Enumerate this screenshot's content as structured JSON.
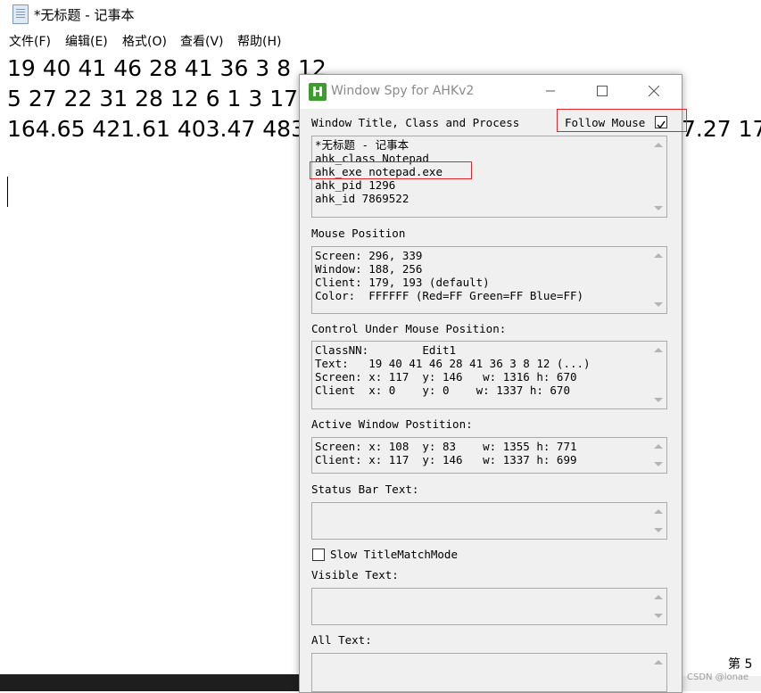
{
  "notepad": {
    "title": "*无标题 - 记事本",
    "menu": [
      "文件(F)",
      "编辑(E)",
      "格式(O)",
      "查看(V)",
      "帮助(H)"
    ],
    "lines": [
      "19 40 41 46 28 41 36 3 8 12",
      "5 27 22 31 28 12 6 1 3 17",
      "164.65 421.61 403.47 483"
    ],
    "right_fragment": "7.27 17",
    "status_page": "第 5"
  },
  "spy": {
    "title": "Window Spy for AHKv2",
    "logo_letter": "H",
    "window_section_label": "Window Title, Class and Process",
    "follow_mouse_label": "Follow Mouse",
    "follow_mouse_checked": true,
    "window_lines": [
      "*无标题 - 记事本",
      "ahk_class Notepad",
      "ahk_exe notepad.exe",
      "ahk_pid 1296",
      "ahk_id 7869522"
    ],
    "mouse_label": "Mouse Position",
    "mouse_lines": [
      "Screen: 296, 339",
      "Window: 188, 256",
      "Client: 179, 193 (default)",
      "Color:  FFFFFF (Red=FF Green=FF Blue=FF)"
    ],
    "control_label": "Control Under Mouse Position:",
    "control_lines": [
      "ClassNN:        Edit1",
      "Text:   19 40 41 46 28 41 36 3 8 12 (...)",
      "Screen: x: 117  y: 146   w: 1316 h: 670",
      "Client  x: 0    y: 0    w: 1337 h: 670"
    ],
    "active_label": "Active Window Postition:",
    "active_lines": [
      "Screen: x: 108  y: 83    w: 1355 h: 771",
      "Client: x: 117  y: 146   w: 1337 h: 699"
    ],
    "statusbar_label": "Status Bar Text:",
    "slow_label": "Slow TitleMatchMode",
    "slow_checked": false,
    "visible_label": "Visible Text:",
    "all_label": "All Text:"
  },
  "watermark": "CSDN @lonae",
  "colors": {
    "highlight": "#e0252b",
    "logo": "#3c9d2c"
  }
}
